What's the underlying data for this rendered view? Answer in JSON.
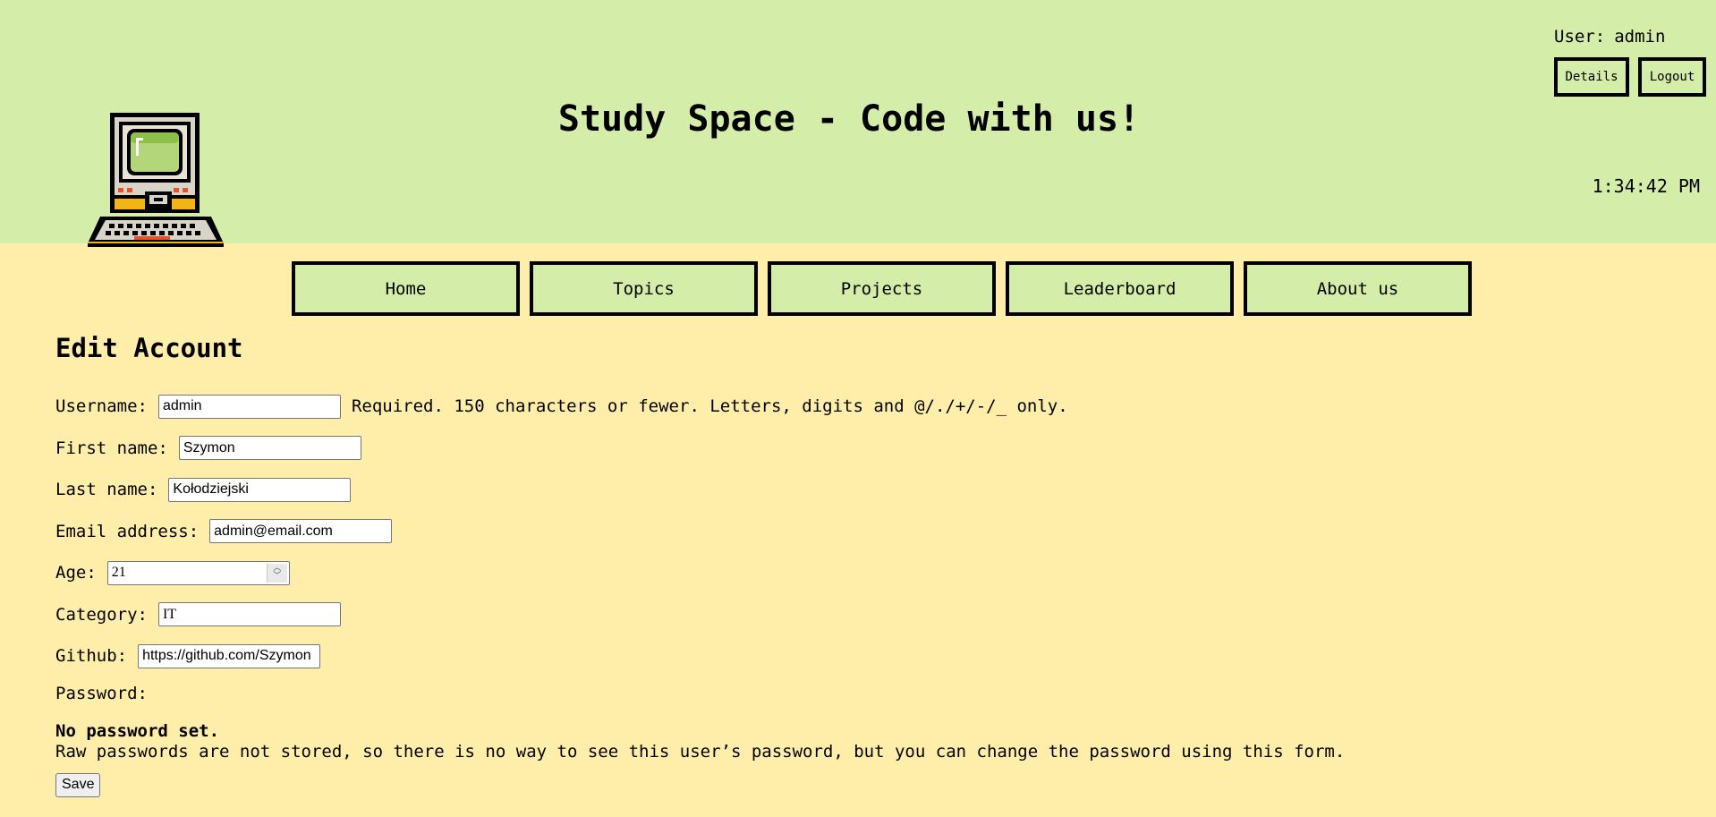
{
  "header": {
    "site_title": "Study Space - Code with us!",
    "user_label": "User:",
    "username": "admin",
    "details_button": "Details",
    "logout_button": "Logout",
    "clock": "1:34:42 PM",
    "logo_icon": "retro-computer-icon",
    "background_color": "#d4eda8"
  },
  "nav": {
    "items": [
      "Home",
      "Topics",
      "Projects",
      "Leaderboard",
      "About us"
    ]
  },
  "main": {
    "title": "Edit Account",
    "background_color": "#ffeeaa",
    "fields": {
      "username": {
        "label": "Username:",
        "value": "admin",
        "help": "Required. 150 characters or fewer. Letters, digits and @/./+/-/_ only."
      },
      "first_name": {
        "label": "First name:",
        "value": "Szymon"
      },
      "last_name": {
        "label": "Last name:",
        "value": "Kołodziejski"
      },
      "email": {
        "label": "Email address:",
        "value": "admin@email.com"
      },
      "age": {
        "label": "Age:",
        "value": "21"
      },
      "category": {
        "label": "Category:",
        "value": "IT"
      },
      "github": {
        "label": "Github:",
        "value": "https://github.com/Szymon"
      }
    },
    "password": {
      "label": "Password:",
      "status": "No password set.",
      "info": "Raw passwords are not stored, so there is no way to see this user’s password, but you can change the password using this form."
    },
    "save_button": "Save"
  }
}
